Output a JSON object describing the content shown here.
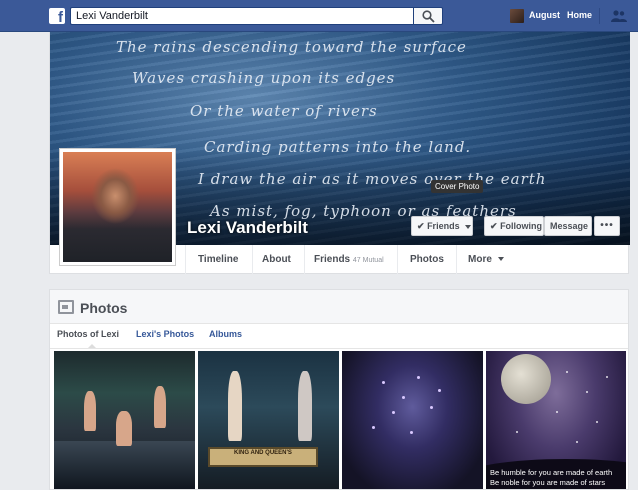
{
  "topbar": {
    "logo": "f",
    "search_value": "Lexi Vanderbilt",
    "user_name": "August",
    "home_label": "Home",
    "bg_color": "#3b5998"
  },
  "profile": {
    "name": "Lexi Vanderbilt",
    "cover_tooltip": "Cover Photo",
    "poem_lines": [
      "The rains descending toward the surface",
      "Waves crashing upon its edges",
      "Or the water of rivers",
      "Carding patterns into the land.",
      "I draw the air as it moves over the earth",
      "As mist, fog, typhoon or as feathers"
    ],
    "buttons": {
      "friends": "Friends",
      "following": "Following",
      "message": "Message",
      "more": "•••"
    }
  },
  "tabs": {
    "timeline": "Timeline",
    "about": "About",
    "friends": "Friends",
    "friends_sub": "47 Mutual",
    "photos": "Photos",
    "more": "More"
  },
  "photos_section": {
    "title": "Photos",
    "subtabs": [
      "Photos of Lexi",
      "Lexi's Photos",
      "Albums"
    ],
    "photo2_sign": [
      "KING AND QUEEN'S"
    ],
    "photo4_quote": [
      "Be humble for you are made of earth",
      "Be noble for you are made of stars"
    ]
  }
}
